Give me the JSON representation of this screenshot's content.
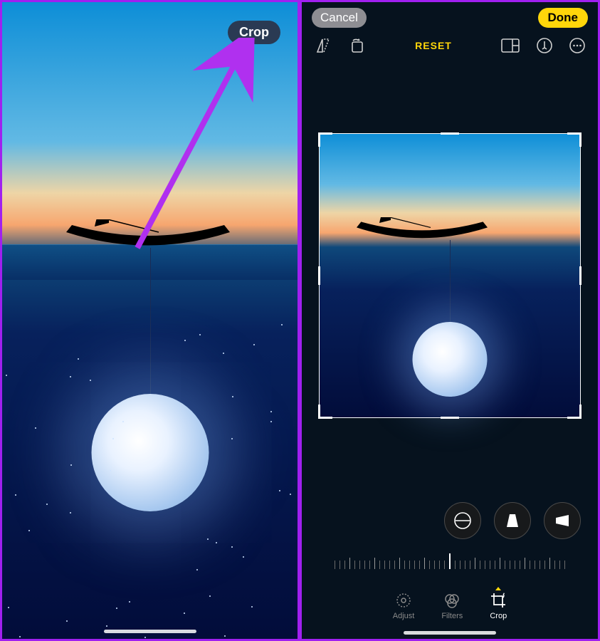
{
  "colors": {
    "annotation_purple": "#a020f0",
    "action_yellow": "#ffd60a"
  },
  "left_screen": {
    "crop_button_label": "Crop"
  },
  "right_screen": {
    "topbar": {
      "cancel_label": "Cancel",
      "done_label": "Done"
    },
    "toolbar": {
      "reset_label": "RESET"
    },
    "rotate_controls": {
      "straighten": "straighten",
      "vertical": "vertical-perspective",
      "horizontal": "horizontal-perspective"
    },
    "bottom_tabs": {
      "adjust": "Adjust",
      "filters": "Filters",
      "crop": "Crop",
      "active": "crop"
    }
  }
}
